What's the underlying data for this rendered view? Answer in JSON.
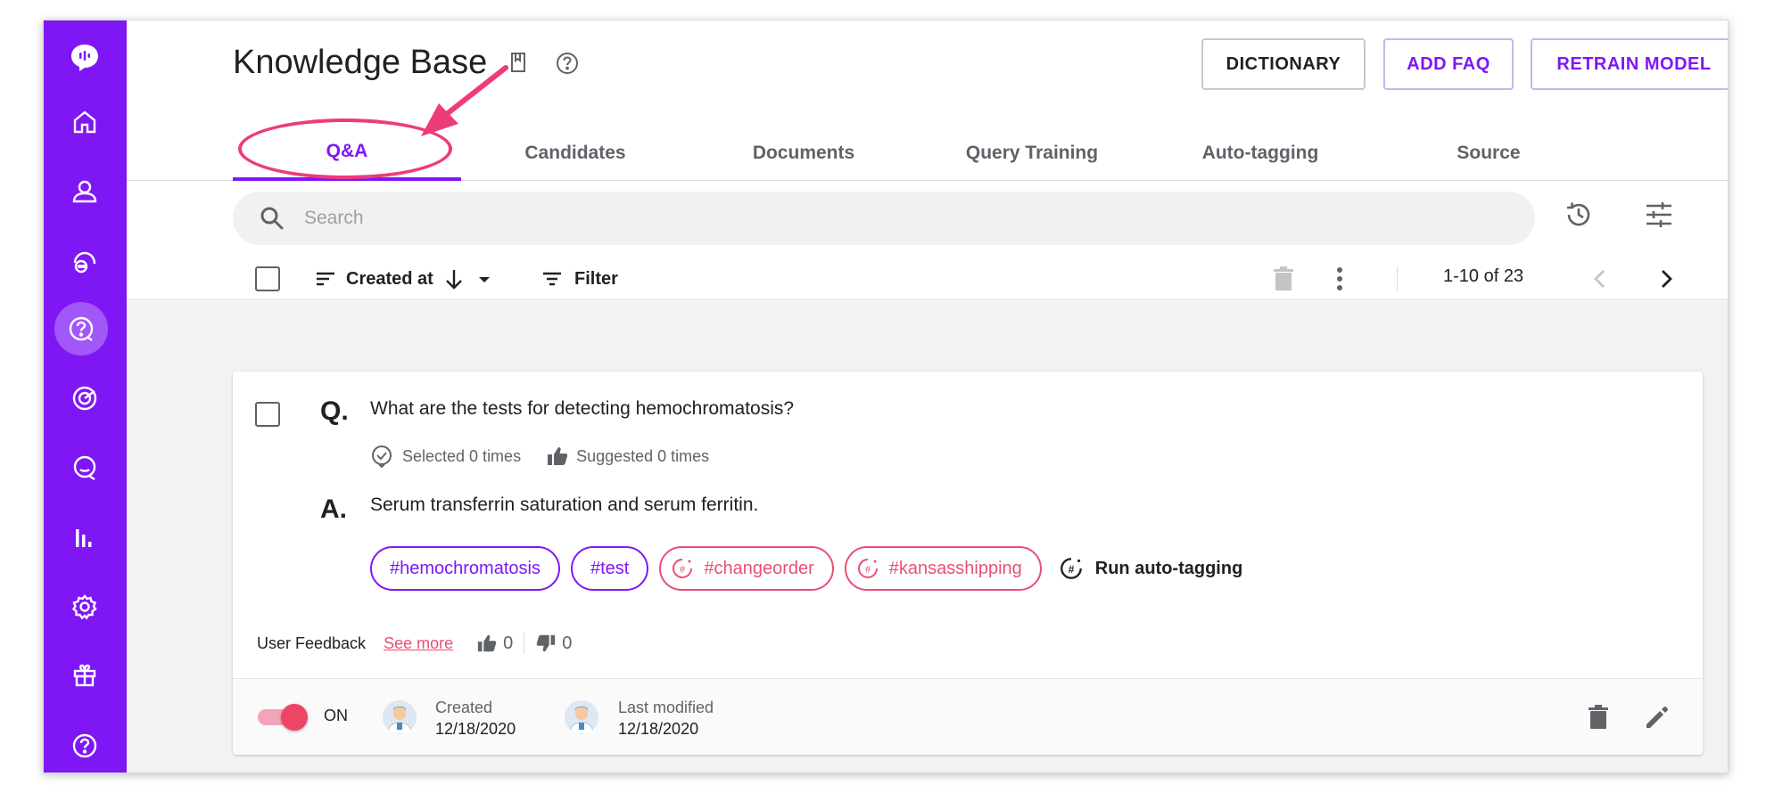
{
  "header": {
    "title": "Knowledge Base",
    "buttons": {
      "dictionary": "DICTIONARY",
      "add_faq": "ADD FAQ",
      "retrain_model": "RETRAIN MODEL"
    }
  },
  "tabs": [
    {
      "label": "Q&A",
      "active": true
    },
    {
      "label": "Candidates"
    },
    {
      "label": "Documents"
    },
    {
      "label": "Query Training"
    },
    {
      "label": "Auto-tagging"
    },
    {
      "label": "Source"
    }
  ],
  "sidebar": {
    "items": [
      "logo-icon",
      "home-icon",
      "user-icon",
      "chat-bubbles-icon",
      "faq-icon",
      "radar-icon",
      "message-icon",
      "analytics-icon",
      "gear-icon",
      "gift-icon",
      "help-icon"
    ],
    "active": "faq-icon"
  },
  "search": {
    "placeholder": "Search",
    "value": ""
  },
  "toolbar": {
    "sort_label": "Created at",
    "filter_label": "Filter",
    "page_range": "1-10 of 23"
  },
  "card": {
    "q_letter": "Q.",
    "question": "What are the tests for detecting hemochromatosis?",
    "selected": "Selected 0 times",
    "suggested": "Suggested 0 times",
    "a_letter": "A.",
    "answer": "Serum transferrin saturation and serum ferritin.",
    "tags": [
      {
        "label": "#hemochromatosis",
        "auto": false
      },
      {
        "label": "#test",
        "auto": false
      },
      {
        "label": "#changeorder",
        "auto": true
      },
      {
        "label": "#kansasshipping",
        "auto": true
      }
    ],
    "run_autotag": "Run auto-tagging",
    "feedback_label": "User Feedback",
    "see_more": "See more",
    "thumbs_up": "0",
    "thumbs_down": "0",
    "toggle_label": "ON",
    "created_label": "Created",
    "created_date": "12/18/2020",
    "modified_label": "Last modified",
    "modified_date": "12/18/2020"
  },
  "colors": {
    "brand": "#7f17f5",
    "accent_pink": "#e84f75",
    "background": "#f2f2f2"
  }
}
